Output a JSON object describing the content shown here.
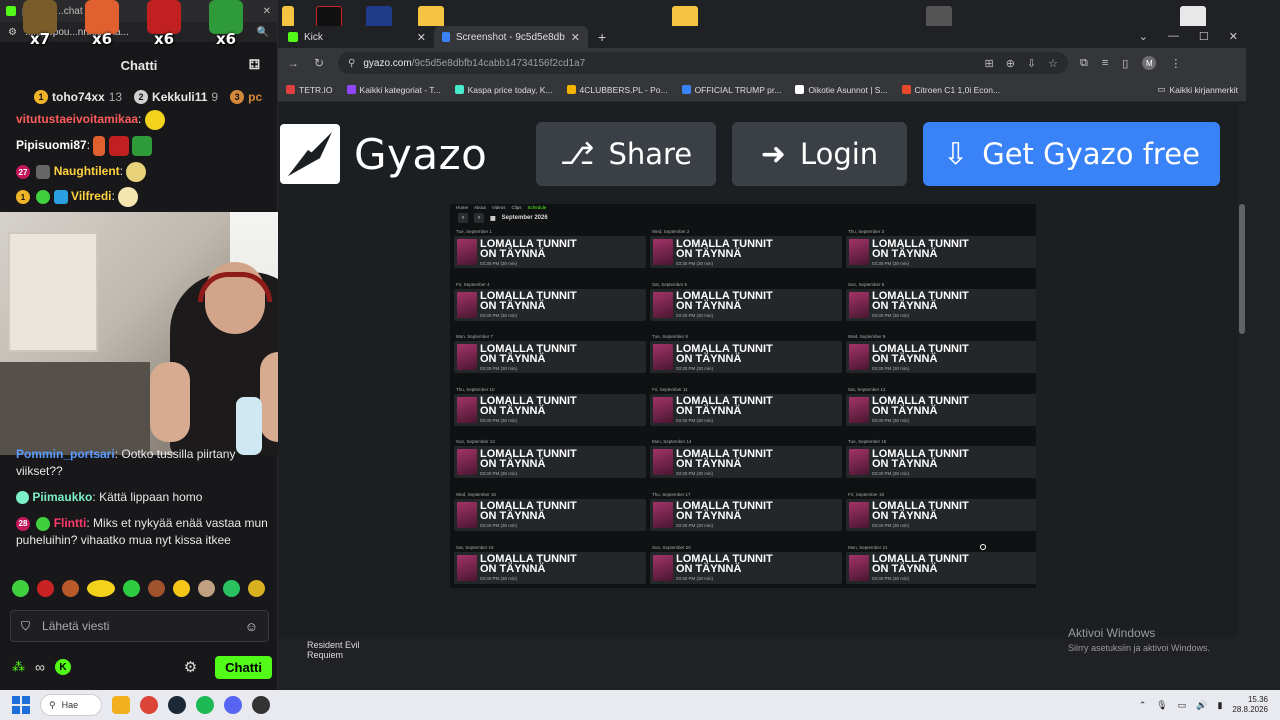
{
  "chat": {
    "browser_url": "...n/popou...nnnis/cha...",
    "title_text": "popout/...chat - Go...",
    "badges": [
      {
        "count": "x7",
        "color": "#7a5b2a"
      },
      {
        "count": "x6",
        "color": "#e06030"
      },
      {
        "count": "x6",
        "color": "#c02020"
      },
      {
        "count": "x6",
        "color": "#2f9a3a"
      }
    ],
    "header": "Chatti",
    "leaderboard": [
      {
        "rank": "1",
        "name": "toho74xx",
        "value": "13",
        "color": "#f0b429"
      },
      {
        "rank": "2",
        "name": "Kekkuli11",
        "value": "9",
        "color": "#d0d0d0"
      },
      {
        "rank": "3",
        "name": "pc",
        "value": "",
        "color": "#d4883a"
      }
    ],
    "messages_top": [
      {
        "user": "vitutustaeivoitamikaa",
        "sep": ":",
        "text": "",
        "color": "#ff5c5c"
      },
      {
        "user": "Pipisuomi87",
        "sep": ":",
        "text": "",
        "color": "#ffffff"
      },
      {
        "user": "Naughtilent",
        "sep": ":",
        "text": "",
        "color": "#ffd23f",
        "badge": "27"
      },
      {
        "user": "Vilfredi",
        "sep": ":",
        "text": "",
        "color": "#ffd23f",
        "badge": "1"
      }
    ],
    "messages_bottom": [
      {
        "user": "Pommin_portsari",
        "sep": ":",
        "text": "Ootko tussilla piirtany viikset??",
        "color": "#5b9bff"
      },
      {
        "user": "Piimaukko",
        "sep": ":",
        "text": "Kättä lippaan homo",
        "color": "#7cf0c8"
      },
      {
        "user": "Flintti",
        "sep": ":",
        "text": "Miks et nykyää enää vastaa mun puheluihin? vihaatko mua nyt kissa itkee",
        "color": "#ff3a6a",
        "badge": "28"
      }
    ],
    "send_placeholder": "Lähetä viesti",
    "chat_button": "Chatti",
    "emote_colors": [
      "#3fcf3f",
      "#c92222",
      "#b85a2a",
      "#f2d21b",
      "#2ecc40",
      "#a0522d",
      "#f5c518",
      "#c0a080",
      "#29c060",
      "#d9b020"
    ]
  },
  "browser": {
    "tabs": [
      {
        "label": "Kick",
        "favicon": "#53fc18",
        "active": false
      },
      {
        "label": "Screenshot - 9c5d5e8dbfb14ca",
        "favicon": "#3a82f7",
        "active": true
      }
    ],
    "url_host": "gyazo.com",
    "url_path": "/9c5d5e8dbfb14cabb14734156f2cd1a7",
    "profile_initial": "M",
    "bookmarks": [
      {
        "label": "TETR.IO",
        "color": "#e04040"
      },
      {
        "label": "Kaikki kategoriat - T...",
        "color": "#9146ff"
      },
      {
        "label": "Kaspa price today, K...",
        "color": "#49eacb"
      },
      {
        "label": "4CLUBBERS.PL - Po...",
        "color": "#f5b400"
      },
      {
        "label": "OFFICIAL TRUMP pr...",
        "color": "#3a82f7"
      },
      {
        "label": "Oikotie Asunnot | S...",
        "color": "#ffffff"
      },
      {
        "label": "Citroen C1 1,0i Econ...",
        "color": "#e8482c"
      }
    ],
    "bookmarks_right": "Kaikki kirjanmerkit"
  },
  "gyazo": {
    "logo": "Gyazo",
    "share": "Share",
    "login": "Login",
    "get": "Get Gyazo free"
  },
  "schedule": {
    "nav": [
      "Home",
      "About",
      "Videos",
      "Clips",
      "Schedule"
    ],
    "month": "September 2026",
    "event_title_1": "LOMALLA TUNNIT",
    "event_title_2": "ON TÄYNNÄ",
    "days": [
      {
        "label": "Tue, September 1",
        "time": "03:30 PM (30 min)"
      },
      {
        "label": "Wed, September 2",
        "time": "03:30 PM (30 min)"
      },
      {
        "label": "Thu, September 3",
        "time": "03:30 PM (30 min)"
      },
      {
        "label": "Fri, September 4",
        "time": "03:30 PM (30 min)"
      },
      {
        "label": "Sat, September 5",
        "time": "03:30 PM (30 min)"
      },
      {
        "label": "Sun, September 6",
        "time": "03:30 PM (30 min)"
      },
      {
        "label": "Mon, September 7",
        "time": "03:30 PM (30 min)"
      },
      {
        "label": "Tue, September 8",
        "time": "03:30 PM (30 min)"
      },
      {
        "label": "Wed, September 9",
        "time": "03:30 PM (30 min)"
      },
      {
        "label": "Thu, September 10",
        "time": "03:30 PM (30 min)"
      },
      {
        "label": "Fri, September 11",
        "time": "03:30 PM (30 min)"
      },
      {
        "label": "Sat, September 12",
        "time": "03:30 PM (30 min)"
      },
      {
        "label": "Sun, September 13",
        "time": "03:30 PM (30 min)"
      },
      {
        "label": "Mon, September 14",
        "time": "03:30 PM (30 min)"
      },
      {
        "label": "Tue, September 15",
        "time": "03:30 PM (30 min)"
      },
      {
        "label": "Wed, September 16",
        "time": "03:30 PM (30 min)"
      },
      {
        "label": "Thu, September 17",
        "time": "03:30 PM (30 min)"
      },
      {
        "label": "Fri, September 18",
        "time": "03:30 PM (30 min)"
      },
      {
        "label": "Sat, September 19",
        "time": "03:30 PM (30 min)"
      },
      {
        "label": "Sun, September 20",
        "time": "03:30 PM (30 min)"
      },
      {
        "label": "Mon, September 21",
        "time": "03:30 PM (30 min)"
      }
    ]
  },
  "desktop": {
    "game_label_1": "Resident Evil",
    "game_label_2": "Requiem",
    "activate_title": "Aktivoi Windows",
    "activate_sub": "Siirry asetuksiin ja aktivoi Windows.",
    "icons": [
      "#d33",
      "#2b5bd7",
      "#f5c542",
      "#f5c542",
      "#555",
      "#e8e8e8"
    ]
  },
  "taskbar": {
    "search_label": "Hae",
    "apps": [
      "#f2b01e",
      "#db4437",
      "#1b2838",
      "#1db954",
      "#5865f2",
      "#333333"
    ],
    "time": "15.36",
    "date": "28.8.2026"
  }
}
